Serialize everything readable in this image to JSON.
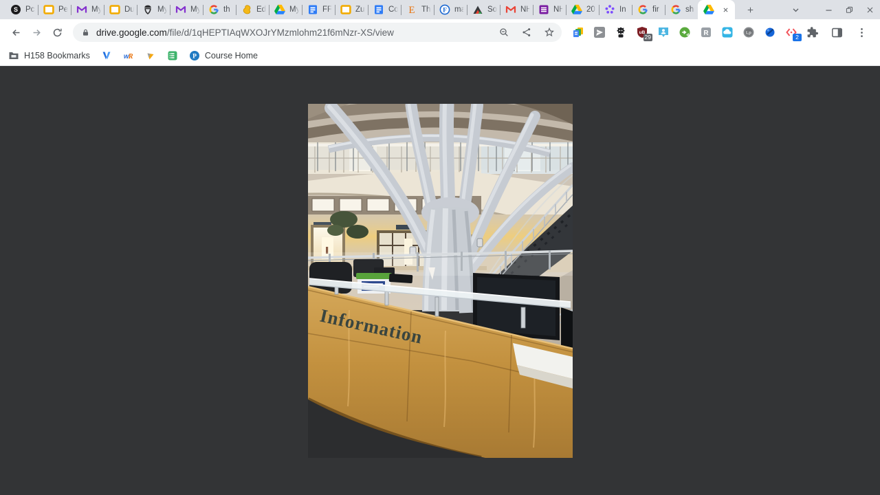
{
  "tabs": {
    "items": [
      {
        "icon": "skype-circle-icon",
        "label": "Pc"
      },
      {
        "icon": "yellow-window-icon",
        "label": "Pe"
      },
      {
        "icon": "purple-mail-icon",
        "label": "My"
      },
      {
        "icon": "yellow-window-icon",
        "label": "Du"
      },
      {
        "icon": "acorn-icon",
        "label": "My"
      },
      {
        "icon": "purple-mail-icon",
        "label": "My"
      },
      {
        "icon": "google-g-icon",
        "label": "th"
      },
      {
        "icon": "gold-blob-icon",
        "label": "Ed"
      },
      {
        "icon": "drive-icon",
        "label": "My"
      },
      {
        "icon": "blue-doc-icon",
        "label": "FF"
      },
      {
        "icon": "yellow-window-icon",
        "label": "Zu"
      },
      {
        "icon": "blue-doc-icon",
        "label": "Co"
      },
      {
        "icon": "orange-e-icon",
        "label": "Th"
      },
      {
        "icon": "blue-f-circle-icon",
        "label": "ma"
      },
      {
        "icon": "mountain-icon",
        "label": "So"
      },
      {
        "icon": "gmail-icon",
        "label": "NH"
      },
      {
        "icon": "purple-list-icon",
        "label": "NH"
      },
      {
        "icon": "drive-icon",
        "label": "20"
      },
      {
        "icon": "purple-burst-icon",
        "label": "In"
      },
      {
        "icon": "google-g-icon",
        "label": "fir"
      },
      {
        "icon": "google-g-icon",
        "label": "sh"
      },
      {
        "icon": "drive-icon",
        "label": "",
        "active": true
      }
    ]
  },
  "toolbar": {
    "url_domain": "drive.google.com",
    "url_path": "/file/d/1qHEPTIAqWXOJrYMzmlohm21f6mNzr-XS/view",
    "extensions": [
      {
        "icon": "docs-stack-icon"
      },
      {
        "icon": "gray-plane-icon"
      },
      {
        "icon": "black-robot-icon"
      },
      {
        "icon": "ublock-shield-icon",
        "badge": "29",
        "badge_color": "#606368"
      },
      {
        "icon": "teal-person-icon"
      },
      {
        "icon": "green-circle-icon"
      },
      {
        "icon": "gray-r-icon"
      },
      {
        "icon": "teal-cloud-icon"
      },
      {
        "icon": "lastpass-gray-icon"
      },
      {
        "icon": "blue-sphere-icon"
      },
      {
        "icon": "pink-brackets-icon",
        "badge": "2",
        "badge_color": "#1a73e8"
      }
    ]
  },
  "bookmarks": {
    "items": [
      {
        "icon": "bookmarks-folder-icon",
        "label": "H158 Bookmarks"
      },
      {
        "icon": "blue-v-icon",
        "label": ""
      },
      {
        "icon": "wr-icon",
        "label": ""
      },
      {
        "icon": "gold-sail-icon",
        "label": ""
      },
      {
        "icon": "green-grid-icon",
        "label": ""
      },
      {
        "icon": "piazza-icon",
        "label": "Course Home"
      }
    ]
  },
  "content": {
    "photo": {
      "sign_text": "Information"
    }
  },
  "colors": {
    "accent_blue": "#1a73e8",
    "tabstrip_bg": "#dee1e6",
    "content_bg": "#333436",
    "desk_wood": "#c3913f",
    "sign_text_color": "#3a453f"
  }
}
